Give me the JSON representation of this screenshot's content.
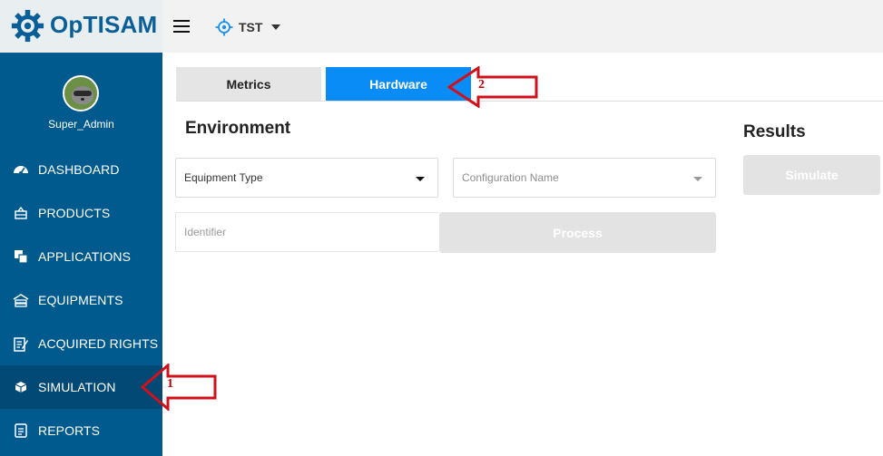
{
  "app": {
    "name": "OpTISAM"
  },
  "profile": {
    "username": "Super_Admin"
  },
  "topbar": {
    "scope": "TST"
  },
  "sidebar": {
    "items": [
      {
        "label": "DASHBOARD",
        "icon": "dashboard-icon"
      },
      {
        "label": "PRODUCTS",
        "icon": "products-icon"
      },
      {
        "label": "APPLICATIONS",
        "icon": "applications-icon"
      },
      {
        "label": "EQUIPMENTS",
        "icon": "equipments-icon"
      },
      {
        "label": "ACQUIRED RIGHTS",
        "icon": "acquired-rights-icon"
      },
      {
        "label": "SIMULATION",
        "icon": "simulation-icon",
        "active": true
      },
      {
        "label": "REPORTS",
        "icon": "reports-icon"
      }
    ]
  },
  "tabs": [
    {
      "label": "Metrics",
      "active": false
    },
    {
      "label": "Hardware",
      "active": true
    }
  ],
  "environment": {
    "title": "Environment",
    "equipment_type": {
      "placeholder": "Equipment Type"
    },
    "configuration_name": {
      "placeholder": "Configuration Name"
    },
    "identifier": {
      "placeholder": "Identifier"
    },
    "process_label": "Process"
  },
  "results": {
    "title": "Results",
    "simulate_label": "Simulate"
  },
  "annotations": [
    {
      "label": "1",
      "color": "#c00000"
    },
    {
      "label": "2",
      "color": "#c00000"
    }
  ],
  "colors": {
    "sidebar": "#005a8e",
    "sidebar_active": "#024a75",
    "tab_active": "#0a8cf6",
    "brand": "#0b5f98",
    "disabled_button": "#e3e3e3"
  }
}
